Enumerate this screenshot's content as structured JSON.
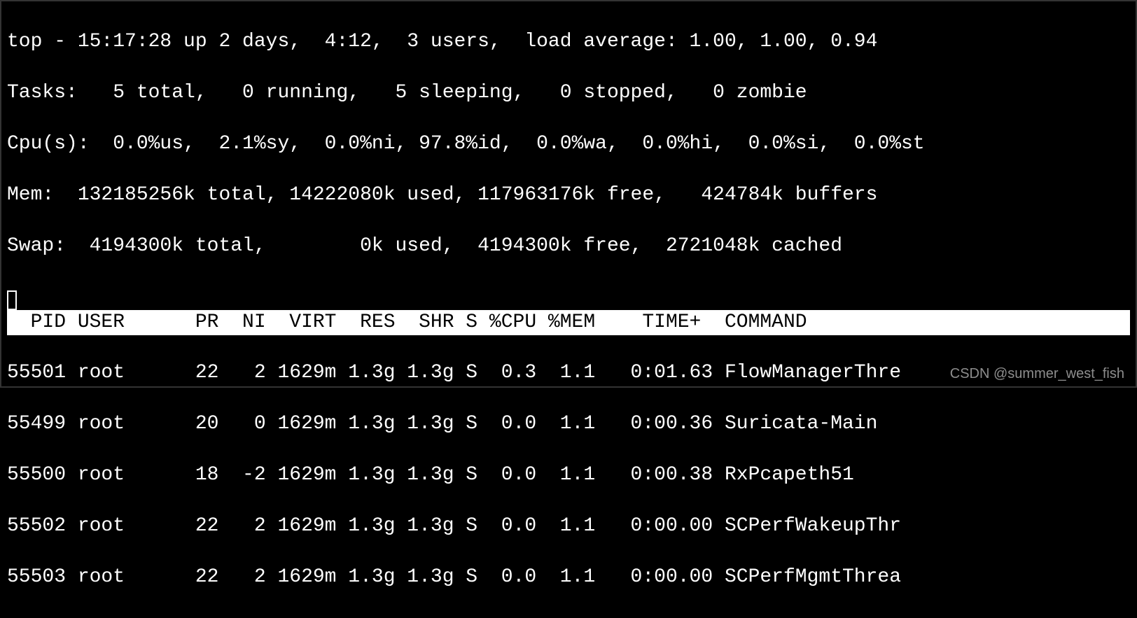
{
  "summary": {
    "line1": "top - 15:17:28 up 2 days,  4:12,  3 users,  load average: 1.00, 1.00, 0.94",
    "line2": "Tasks:   5 total,   0 running,   5 sleeping,   0 stopped,   0 zombie",
    "line3": "Cpu(s):  0.0%us,  2.1%sy,  0.0%ni, 97.8%id,  0.0%wa,  0.0%hi,  0.0%si,  0.0%st",
    "line4": "Mem:  132185256k total, 14222080k used, 117963176k free,   424784k buffers",
    "line5": "Swap:  4194300k total,        0k used,  4194300k free,  2721048k cached"
  },
  "columns": {
    "header": "  PID USER      PR  NI  VIRT  RES  SHR S %CPU %MEM    TIME+  COMMAND"
  },
  "processes": [
    {
      "pid": "55501",
      "user": "root",
      "pr": "22",
      "ni": "2",
      "virt": "1629m",
      "res": "1.3g",
      "shr": "1.3g",
      "s": "S",
      "cpu": "0.3",
      "mem": "1.1",
      "time": "0:01.63",
      "command": "FlowManagerThre",
      "row": "55501 root      22   2 1629m 1.3g 1.3g S  0.3  1.1   0:01.63 FlowManagerThre"
    },
    {
      "pid": "55499",
      "user": "root",
      "pr": "20",
      "ni": "0",
      "virt": "1629m",
      "res": "1.3g",
      "shr": "1.3g",
      "s": "S",
      "cpu": "0.0",
      "mem": "1.1",
      "time": "0:00.36",
      "command": "Suricata-Main",
      "row": "55499 root      20   0 1629m 1.3g 1.3g S  0.0  1.1   0:00.36 Suricata-Main"
    },
    {
      "pid": "55500",
      "user": "root",
      "pr": "18",
      "ni": "-2",
      "virt": "1629m",
      "res": "1.3g",
      "shr": "1.3g",
      "s": "S",
      "cpu": "0.0",
      "mem": "1.1",
      "time": "0:00.38",
      "command": "RxPcapeth51",
      "row": "55500 root      18  -2 1629m 1.3g 1.3g S  0.0  1.1   0:00.38 RxPcapeth51"
    },
    {
      "pid": "55502",
      "user": "root",
      "pr": "22",
      "ni": "2",
      "virt": "1629m",
      "res": "1.3g",
      "shr": "1.3g",
      "s": "S",
      "cpu": "0.0",
      "mem": "1.1",
      "time": "0:00.00",
      "command": "SCPerfWakeupThr",
      "row": "55502 root      22   2 1629m 1.3g 1.3g S  0.0  1.1   0:00.00 SCPerfWakeupThr"
    },
    {
      "pid": "55503",
      "user": "root",
      "pr": "22",
      "ni": "2",
      "virt": "1629m",
      "res": "1.3g",
      "shr": "1.3g",
      "s": "S",
      "cpu": "0.0",
      "mem": "1.1",
      "time": "0:00.00",
      "command": "SCPerfMgmtThrea",
      "row": "55503 root      22   2 1629m 1.3g 1.3g S  0.0  1.1   0:00.00 SCPerfMgmtThrea"
    }
  ],
  "watermark": "CSDN @summer_west_fish"
}
